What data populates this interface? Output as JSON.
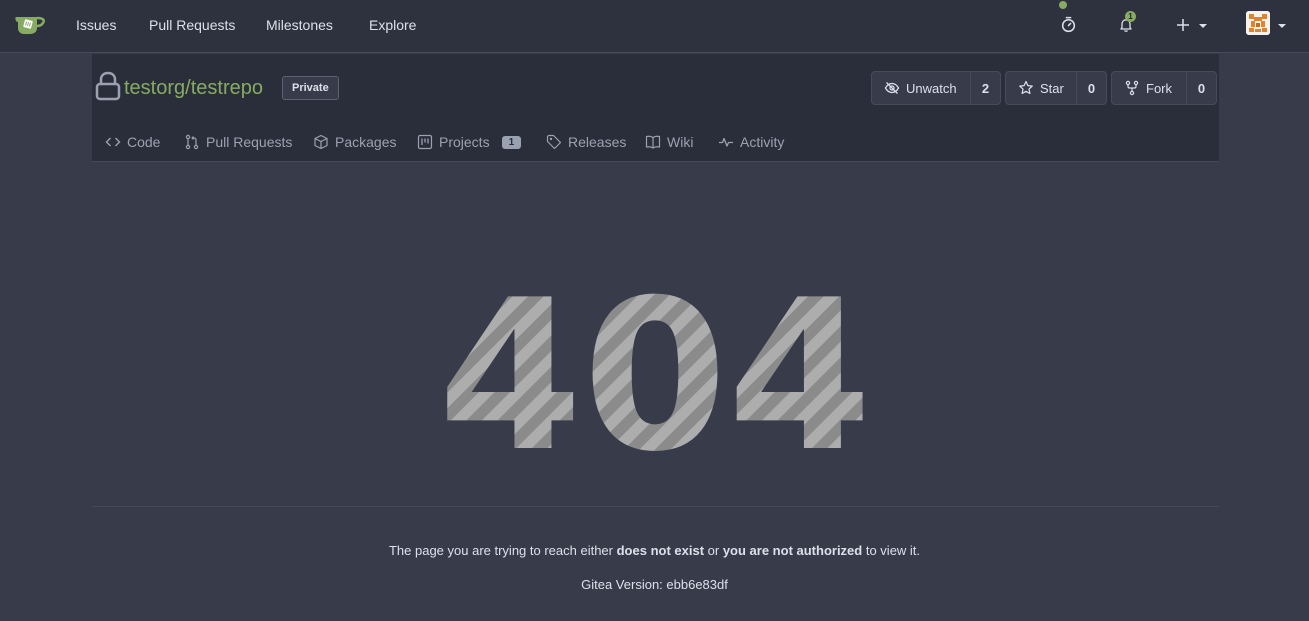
{
  "nav": {
    "links": [
      "Issues",
      "Pull Requests",
      "Milestones",
      "Explore"
    ],
    "notification_count": "1"
  },
  "repo": {
    "owner": "testorg",
    "separator": "/",
    "name": "testrepo",
    "visibility_badge": "Private",
    "actions": {
      "watch": {
        "label": "Unwatch",
        "count": "2"
      },
      "star": {
        "label": "Star",
        "count": "0"
      },
      "fork": {
        "label": "Fork",
        "count": "0"
      }
    },
    "tabs": [
      {
        "label": "Code",
        "icon": "code-icon"
      },
      {
        "label": "Pull Requests",
        "icon": "git-pull-request-icon"
      },
      {
        "label": "Packages",
        "icon": "package-icon"
      },
      {
        "label": "Projects",
        "icon": "project-icon",
        "count": "1"
      },
      {
        "label": "Releases",
        "icon": "tag-icon"
      },
      {
        "label": "Wiki",
        "icon": "book-icon"
      },
      {
        "label": "Activity",
        "icon": "pulse-icon"
      }
    ]
  },
  "error": {
    "code": "404",
    "message_part1": "The page you are trying to reach either ",
    "message_bold1": "does not exist",
    "message_part2": " or ",
    "message_bold2": "you are not authorized",
    "message_part3": " to view it.",
    "version": "Gitea Version: ebb6e83df"
  },
  "colors": {
    "accent_green": "#87ab63",
    "background": "#383c4a",
    "nav_background": "#2e323e",
    "stripe_light": "#adadad",
    "stripe_dark": "#8b8b8b"
  }
}
